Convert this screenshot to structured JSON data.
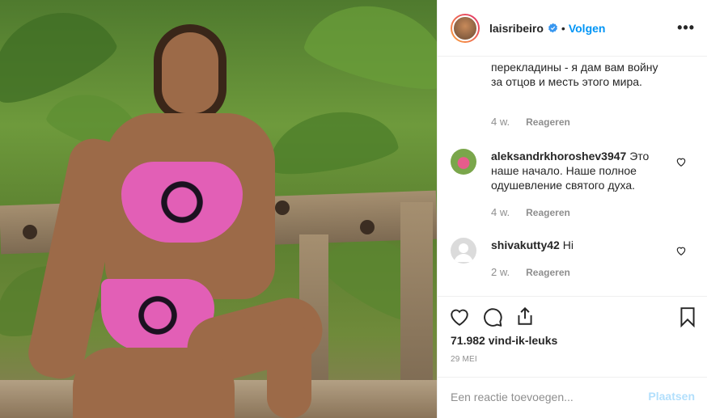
{
  "post": {
    "username": "laisribeiro",
    "separator": "•",
    "follow_label": "Volgen",
    "more_label": "•••",
    "verified": true
  },
  "comments": [
    {
      "username": "",
      "text": "перекладины - я дам вам войну за отцов и месть этого мира.",
      "time": "4 w.",
      "reply_label": "Reageren"
    },
    {
      "username": "aleksandrkhoroshev3947",
      "text": "Это наше начало. Наше полное одушевление святого духа.",
      "time": "4 w.",
      "reply_label": "Reageren",
      "avatar": "flower-avatar"
    },
    {
      "username": "shivakutty42",
      "text": "Hi",
      "time": "2 w.",
      "reply_label": "Reageren",
      "avatar": "default-avatar"
    }
  ],
  "actions": {
    "icons": [
      "heart-icon",
      "comment-icon",
      "share-icon",
      "bookmark-icon"
    ],
    "likes": "71.982 vind-ik-leuks",
    "date": "29 MEI"
  },
  "add_comment": {
    "placeholder": "Een reactie toevoegen...",
    "post_label": "Plaatsen"
  },
  "colors": {
    "accent": "#0095f6",
    "post_disabled": "#b2dffc",
    "muted": "#8e8e8e"
  }
}
